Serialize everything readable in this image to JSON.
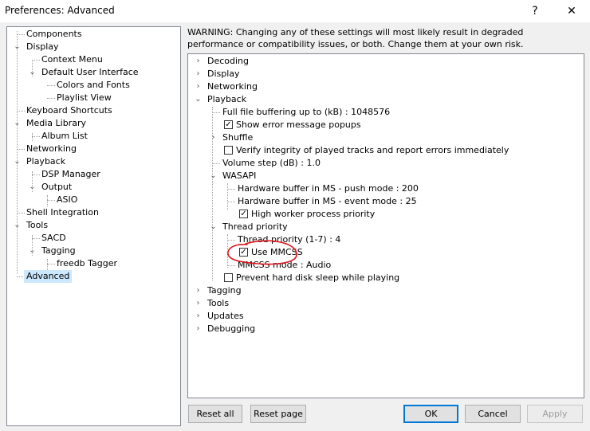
{
  "window": {
    "title": "Preferences: Advanced",
    "help_glyph": "?",
    "close_glyph": "✕"
  },
  "left_tree": [
    {
      "label": "Components"
    },
    {
      "label": "Display"
    },
    {
      "label": "Context Menu"
    },
    {
      "label": "Default User Interface"
    },
    {
      "label": "Colors and Fonts"
    },
    {
      "label": "Playlist View"
    },
    {
      "label": "Keyboard Shortcuts"
    },
    {
      "label": "Media Library"
    },
    {
      "label": "Album List"
    },
    {
      "label": "Networking"
    },
    {
      "label": "Playback"
    },
    {
      "label": "DSP Manager"
    },
    {
      "label": "Output"
    },
    {
      "label": "ASIO"
    },
    {
      "label": "Shell Integration"
    },
    {
      "label": "Tools"
    },
    {
      "label": "SACD"
    },
    {
      "label": "Tagging"
    },
    {
      "label": "freedb Tagger"
    },
    {
      "label": "Advanced"
    }
  ],
  "warning": "WARNING: Changing any of these settings will most likely result in degraded performance or compatibility issues, or both. Change them at your own risk.",
  "right_tree": [
    {
      "label": "Decoding"
    },
    {
      "label": "Display"
    },
    {
      "label": "Networking"
    },
    {
      "label": "Playback"
    },
    {
      "label": "Full file buffering up to (kB) : 1048576"
    },
    {
      "label": "Show error message popups"
    },
    {
      "label": "Shuffle"
    },
    {
      "label": "Verify integrity of played tracks and report errors immediately"
    },
    {
      "label": "Volume step (dB) : 1.0"
    },
    {
      "label": "WASAPI"
    },
    {
      "label": "Hardware buffer in MS - push mode : 200"
    },
    {
      "label": "Hardware buffer in MS - event mode : 25"
    },
    {
      "label": "High worker process priority"
    },
    {
      "label": "Thread priority"
    },
    {
      "label": "Thread priority (1-7) : 4"
    },
    {
      "label": "Use MMCSS"
    },
    {
      "label": "MMCSS mode : Audio"
    },
    {
      "label": "Prevent hard disk sleep while playing"
    },
    {
      "label": "Tagging"
    },
    {
      "label": "Tools"
    },
    {
      "label": "Updates"
    },
    {
      "label": "Debugging"
    }
  ],
  "buttons": {
    "reset_all": "Reset all",
    "reset_page": "Reset page",
    "ok": "OK",
    "cancel": "Cancel",
    "apply": "Apply"
  },
  "glyphs": {
    "collapsed": "›",
    "expanded": "⌄",
    "check": "✓"
  },
  "colors": {
    "selection": "#cce8ff",
    "annotation": "#e0151b",
    "default_button_border": "#0078d7"
  }
}
